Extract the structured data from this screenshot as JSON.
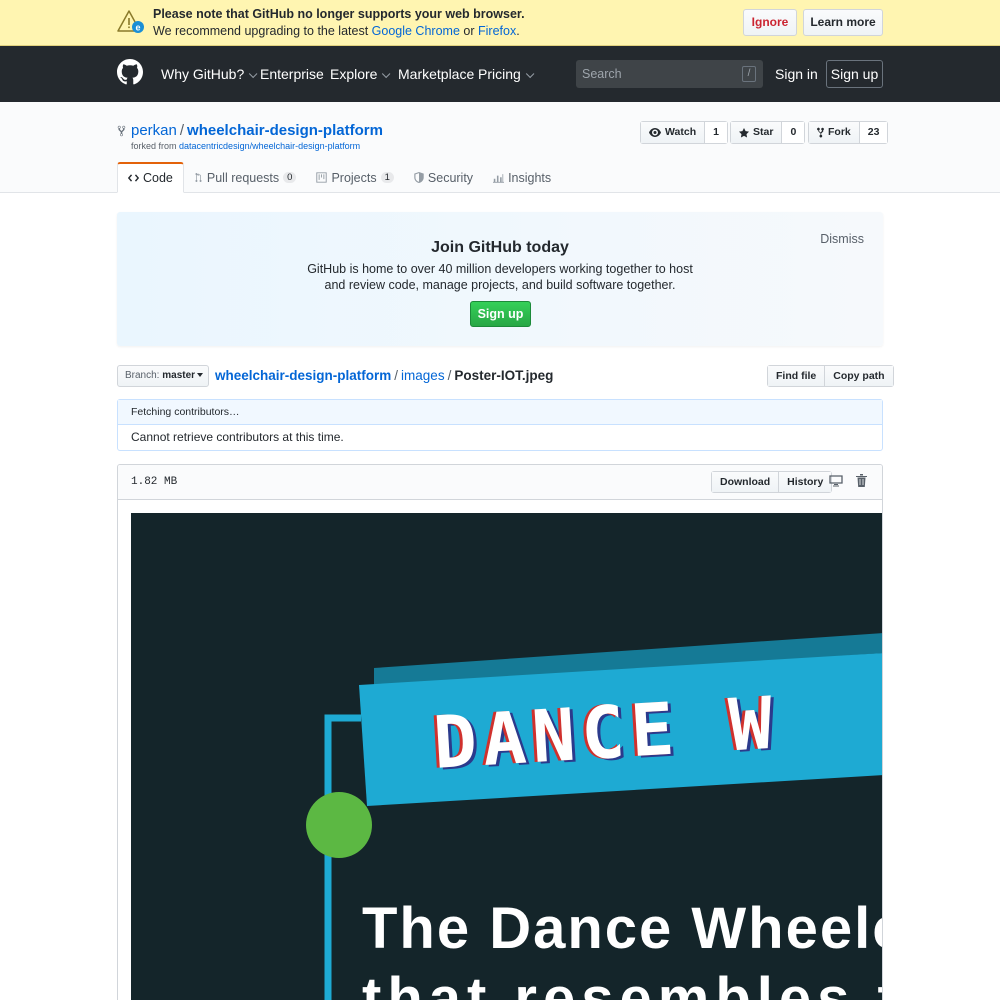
{
  "banner": {
    "title": "Please note that GitHub no longer supports your web browser.",
    "sub_prefix": "We recommend upgrading to the latest",
    "chrome": "Google Chrome",
    "or": "or",
    "firefox": "Firefox",
    "period": ".",
    "ignore": "Ignore",
    "learn_more": "Learn more"
  },
  "header": {
    "nav": [
      "Why GitHub?",
      "Enterprise",
      "Explore",
      "Marketplace",
      "Pricing"
    ],
    "search_placeholder": "Search",
    "search_key": "/",
    "sign_in": "Sign in",
    "sign_up": "Sign up"
  },
  "repo": {
    "owner": "perkan",
    "separator": "/",
    "name": "wheelchair-design-platform",
    "forked_prefix": "forked from",
    "forked_from": "datacentricdesign/wheelchair-design-platform",
    "watch": {
      "label": "Watch",
      "count": "1"
    },
    "star": {
      "label": "Star",
      "count": "0"
    },
    "fork": {
      "label": "Fork",
      "count": "23"
    },
    "tabs": {
      "code": "Code",
      "pulls": "Pull requests",
      "pulls_count": "0",
      "projects": "Projects",
      "projects_count": "1",
      "security": "Security",
      "insights": "Insights"
    }
  },
  "join": {
    "title": "Join GitHub today",
    "body": "GitHub is home to over 40 million developers working together to host and review code, manage projects, and build software together.",
    "signup": "Sign up",
    "dismiss": "Dismiss"
  },
  "filenav": {
    "branch_label": "Branch:",
    "branch": "master",
    "crumb_root": "wheelchair-design-platform",
    "crumb_dir": "images",
    "sep": "/",
    "file": "Poster-IOT.jpeg",
    "find_file": "Find file",
    "copy_path": "Copy path"
  },
  "contributors": {
    "fetching": "Fetching contributors…",
    "error": "Cannot retrieve contributors at this time."
  },
  "file": {
    "size": "1.82 MB",
    "download": "Download",
    "history": "History"
  },
  "poster": {
    "banner_text": "DANCE W",
    "line1": "The Dance Wheelc",
    "line2": "that resembles the",
    "colors": {
      "bg": "#14252a",
      "banner": "#1eaad3",
      "frame": "#1eaad3",
      "dot": "#5cb843"
    }
  }
}
